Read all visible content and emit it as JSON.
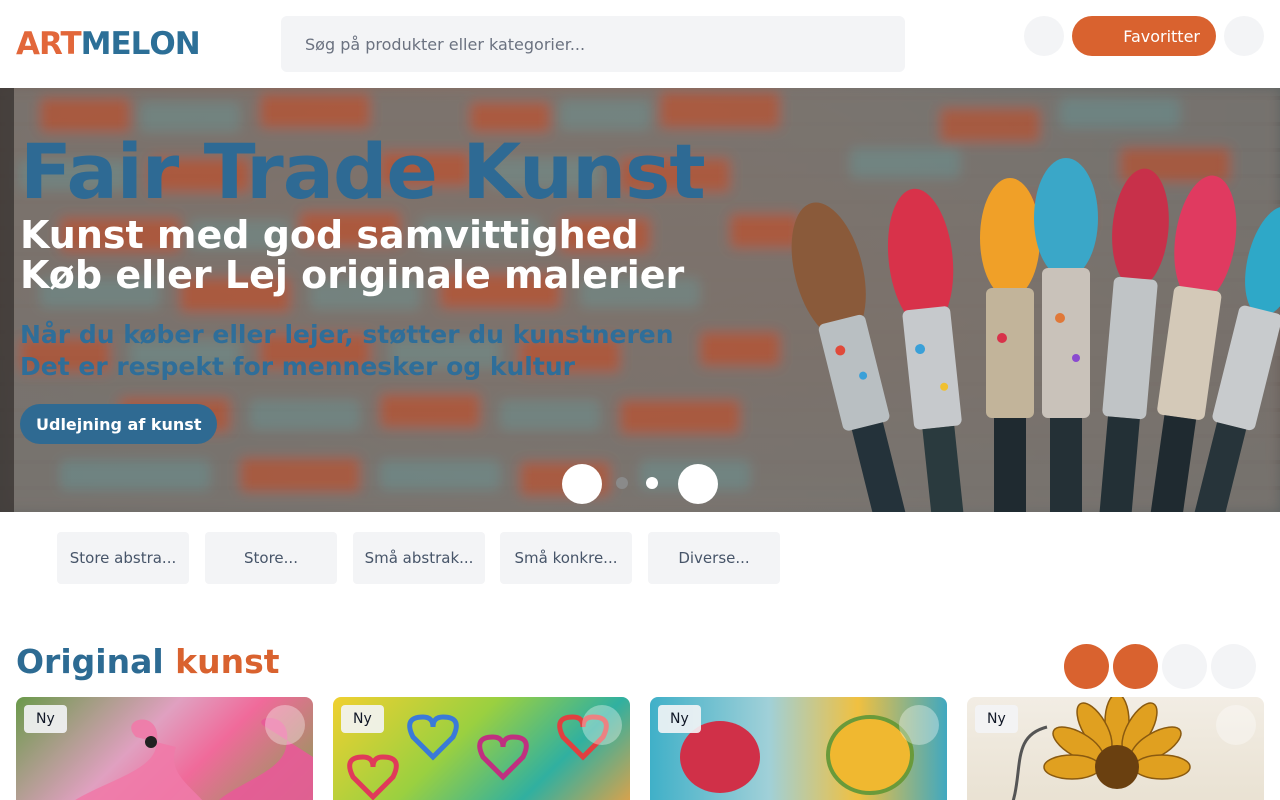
{
  "header": {
    "logo_part1": "ART",
    "logo_part2": "MEL",
    "logo_part3": "ON",
    "search_placeholder": "Søg på produkter eller kategorier...",
    "favorites_label": "Favoritter",
    "accent_color": "#d9622f",
    "brand_blue": "#2c6f97"
  },
  "hero": {
    "title": "Fair Trade Kunst",
    "line1": "Kunst med god samvittighed",
    "line2": "Køb eller Lej originale malerier",
    "sub1": "Når du køber eller lejer, støtter du kunstneren",
    "sub2": "Det er respekt for mennesker og kultur",
    "button_label": "Udlejning af kunst"
  },
  "categories": [
    {
      "label": "Store abstra..."
    },
    {
      "label": "Store..."
    },
    {
      "label": "Små abstrak..."
    },
    {
      "label": "Små konkre..."
    },
    {
      "label": "Diverse..."
    }
  ],
  "section": {
    "title_part1": "Original",
    "title_part2": "kunst"
  },
  "products": [
    {
      "badge": "Ny"
    },
    {
      "badge": "Ny"
    },
    {
      "badge": "Ny"
    },
    {
      "badge": "Ny"
    }
  ]
}
